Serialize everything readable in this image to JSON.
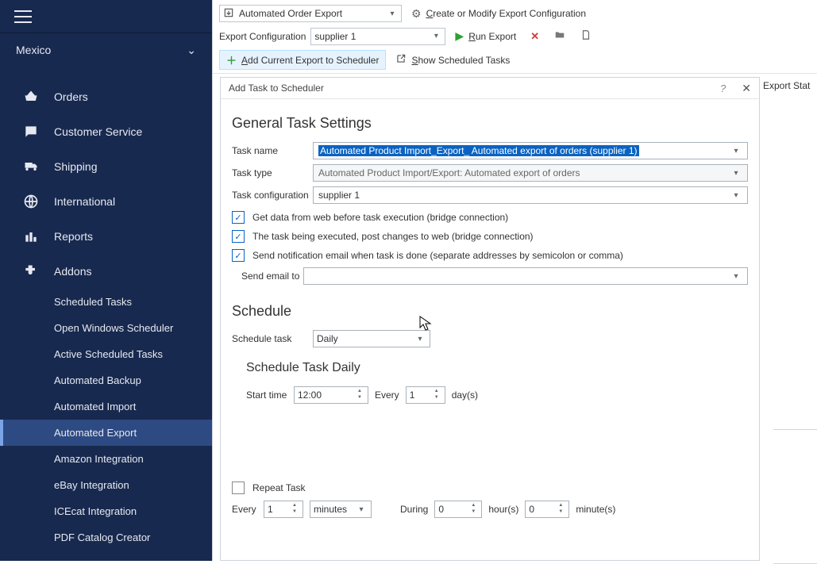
{
  "sidebar": {
    "country": "Mexico",
    "nav": [
      {
        "label": "Orders"
      },
      {
        "label": "Customer Service"
      },
      {
        "label": "Shipping"
      },
      {
        "label": "International"
      },
      {
        "label": "Reports"
      },
      {
        "label": "Addons"
      }
    ],
    "sub": [
      {
        "label": "Scheduled Tasks"
      },
      {
        "label": "Open Windows Scheduler"
      },
      {
        "label": "Active Scheduled Tasks"
      },
      {
        "label": "Automated Backup"
      },
      {
        "label": "Automated Import"
      },
      {
        "label": "Automated Export"
      },
      {
        "label": "Amazon Integration"
      },
      {
        "label": "eBay Integration"
      },
      {
        "label": "ICEcat Integration"
      },
      {
        "label": "PDF Catalog Creator"
      }
    ]
  },
  "toolbar": {
    "type_combo": "Automated Order Export",
    "create_modify": "Create or Modify Export Configuration",
    "config_label": "Export Configuration",
    "config_value": "supplier 1",
    "run_export": "Run Export",
    "add_to_sched": "Add Current Export to Scheduler",
    "show_sched": "Show Scheduled Tasks"
  },
  "right_col_label": "Export Stat",
  "dialog": {
    "title": "Add Task to Scheduler",
    "general_h": "General Task Settings",
    "task_name_label": "Task name",
    "task_name_value": "Automated Product Import_Export_ Automated export of orders (supplier 1)",
    "task_type_label": "Task type",
    "task_type_value": "Automated Product Import/Export: Automated export of orders",
    "task_conf_label": "Task configuration",
    "task_conf_value": "supplier 1",
    "check_get_data": "Get data from web before task execution (bridge connection)",
    "check_post": "The task being executed, post changes to web (bridge connection)",
    "check_email": "Send notification email when task is done (separate addresses by semicolon or comma)",
    "send_email_to_label": "Send email to",
    "schedule_h": "Schedule",
    "schedule_task_label": "Schedule task",
    "schedule_task_value": "Daily",
    "schedule_sub_h": "Schedule Task Daily",
    "start_time_label": "Start time",
    "start_time_value": "12:00",
    "every_label": "Every",
    "every_value": "1",
    "days_label": "day(s)",
    "repeat_label": "Repeat Task",
    "repeat_every_label": "Every",
    "repeat_every_value": "1",
    "repeat_unit_value": "minutes",
    "during_label": "During",
    "during_hours": "0",
    "hours_label": "hour(s)",
    "during_minutes": "0",
    "minutes_label": "minute(s)"
  }
}
